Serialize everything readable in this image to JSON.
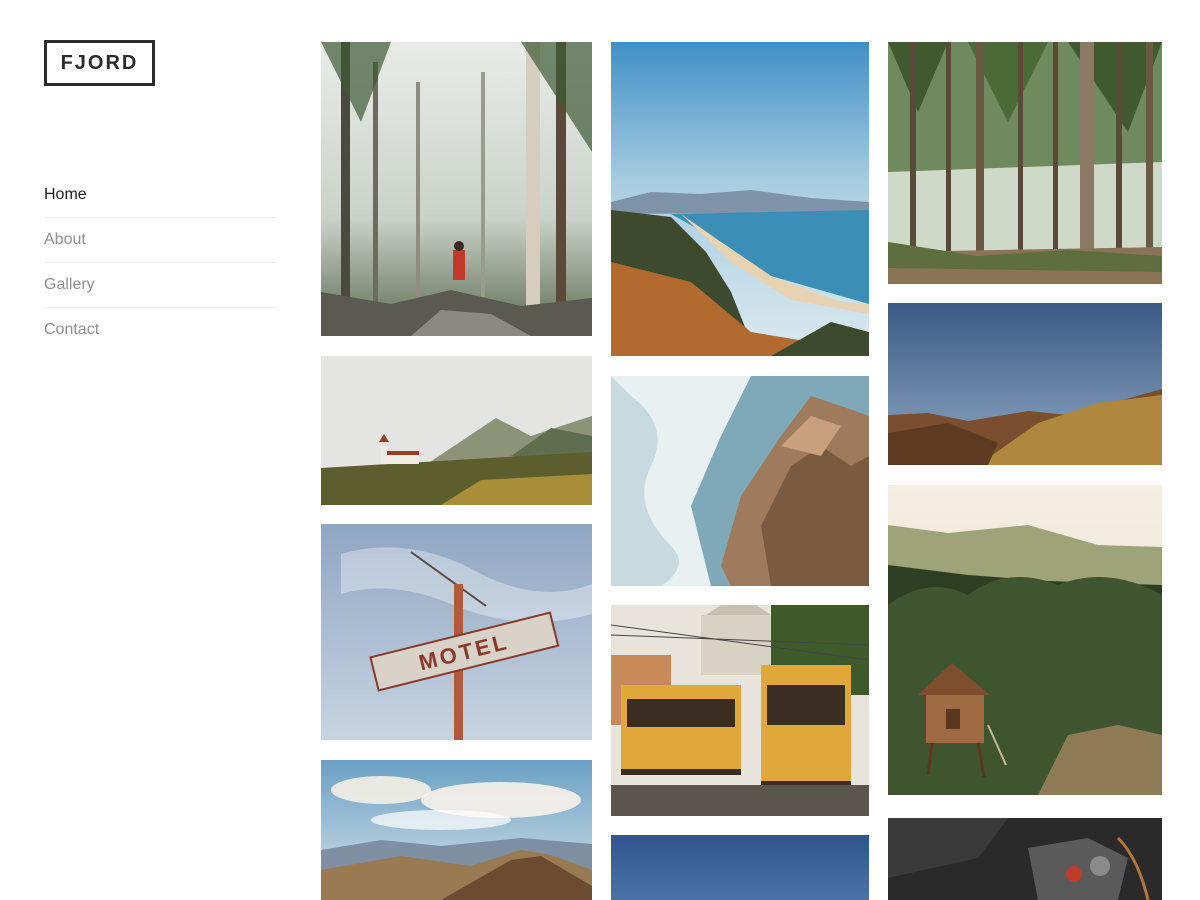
{
  "site": {
    "logo": "FJORD"
  },
  "nav": {
    "items": [
      {
        "label": "Home",
        "active": true
      },
      {
        "label": "About",
        "active": false
      },
      {
        "label": "Gallery",
        "active": false
      },
      {
        "label": "Contact",
        "active": false
      }
    ]
  },
  "gallery": {
    "photos": [
      {
        "id": "misty-forest-hiker",
        "sign": ""
      },
      {
        "id": "coastal-beach-cliff",
        "sign": ""
      },
      {
        "id": "pine-forest",
        "sign": ""
      },
      {
        "id": "church-mountains",
        "sign": ""
      },
      {
        "id": "ocean-waves-rocks",
        "sign": ""
      },
      {
        "id": "dry-hills-blue-sky",
        "sign": ""
      },
      {
        "id": "motel-sign",
        "sign": "MOTEL"
      },
      {
        "id": "yellow-trams",
        "sign": ""
      },
      {
        "id": "forest-hill-cabin",
        "sign": ""
      },
      {
        "id": "mountain-range-clouds",
        "sign": ""
      },
      {
        "id": "blue-sky",
        "sign": ""
      },
      {
        "id": "camera-closeup",
        "sign": ""
      }
    ]
  },
  "colors": {
    "text_active": "#1f1f1f",
    "text_muted": "#8f8f8f",
    "divider": "#ececec",
    "logo": "#2b2b2b"
  }
}
